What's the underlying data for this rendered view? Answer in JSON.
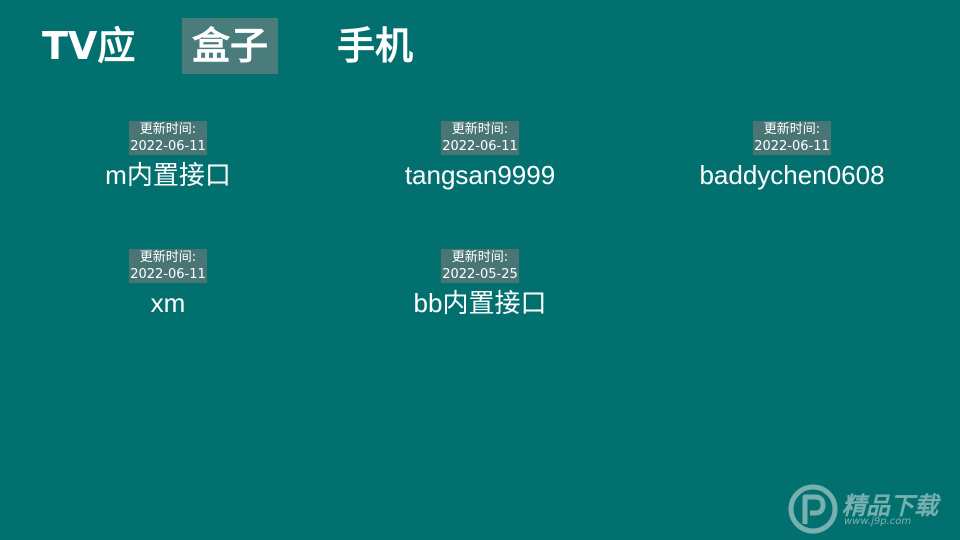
{
  "tabs": [
    {
      "label": "TV应",
      "active": false
    },
    {
      "label": "盒子",
      "active": true
    },
    {
      "label": "手机",
      "active": false
    }
  ],
  "sources": [
    {
      "update_label": "更新时间:",
      "date": "2022-06-11",
      "name": "m内置接口"
    },
    {
      "update_label": "更新时间:",
      "date": "2022-06-11",
      "name": "tangsan9999"
    },
    {
      "update_label": "更新时间:",
      "date": "2022-06-11",
      "name": "baddychen0608"
    },
    {
      "update_label": "更新时间:",
      "date": "2022-06-11",
      "name": "xm"
    },
    {
      "update_label": "更新时间:",
      "date": "2022-05-25",
      "name": "bb内置接口"
    }
  ],
  "watermark": {
    "text": "精品下载",
    "url": "www.j9p.com"
  },
  "colors": {
    "background": "#037070",
    "active_tab": "#4a7c7c",
    "badge": "#4a7575",
    "text": "#ffffff"
  }
}
